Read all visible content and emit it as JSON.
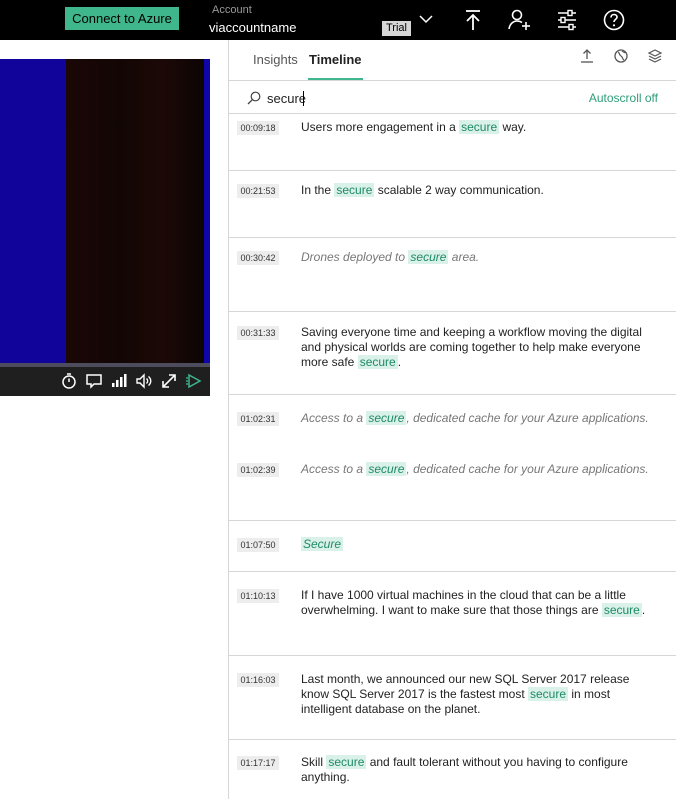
{
  "topbar": {
    "connect_button": "Connect to Azure",
    "account_label": "Account",
    "account_name": "viaccountname",
    "trial_badge": "Trial",
    "icons": [
      "chevron-down-icon",
      "upload-icon",
      "add-person-icon",
      "settings-sliders-icon",
      "help-icon"
    ]
  },
  "player": {
    "controls": [
      "timer-icon",
      "captions-icon",
      "quality-icon",
      "volume-icon",
      "fullscreen-icon",
      "play-speed-icon"
    ]
  },
  "panel": {
    "tabs": [
      {
        "label": "Insights",
        "active": false
      },
      {
        "label": "Timeline",
        "active": true
      }
    ],
    "header_icons": [
      "export-icon",
      "globe-icon",
      "layers-icon"
    ],
    "search": {
      "value": "secure",
      "placeholder": ""
    },
    "autoscroll_label": "Autoscroll off"
  },
  "transcript": [
    {
      "lines": [
        {
          "time": "00:09:18",
          "italic": false,
          "parts": [
            "Users more engagement in a ",
            "secure",
            " way."
          ]
        }
      ]
    },
    {
      "lines": [
        {
          "time": "00:21:53",
          "italic": false,
          "parts": [
            "In the ",
            "secure",
            " scalable 2 way communication."
          ]
        }
      ]
    },
    {
      "lines": [
        {
          "time": "00:30:42",
          "italic": true,
          "parts": [
            "Drones deployed to ",
            "secure",
            " area."
          ]
        }
      ]
    },
    {
      "lines": [
        {
          "time": "00:31:33",
          "italic": false,
          "parts": [
            "Saving everyone time and keeping a workflow moving the digital and physical worlds are coming together to help make everyone more safe ",
            "secure",
            "."
          ]
        }
      ]
    },
    {
      "lines": [
        {
          "time": "01:02:31",
          "italic": true,
          "parts": [
            "Access to a ",
            "secure",
            ", dedicated cache for your Azure applications."
          ]
        },
        {
          "time": "01:02:39",
          "italic": true,
          "parts": [
            "Access to a ",
            "secure",
            ", dedicated cache for your Azure applications."
          ]
        }
      ]
    },
    {
      "lines": [
        {
          "time": "01:07:50",
          "italic": true,
          "parts": [
            "",
            "Secure",
            ""
          ]
        }
      ]
    },
    {
      "lines": [
        {
          "time": "01:10:13",
          "italic": false,
          "parts": [
            "If I have 1000 virtual machines in the cloud that can be a little overwhelming. I want to make sure that those things are ",
            "secure",
            "."
          ]
        }
      ]
    },
    {
      "lines": [
        {
          "time": "01:16:03",
          "italic": false,
          "parts": [
            "Last month, we announced our new SQL Server 2017 release know SQL Server 2017 is the fastest most ",
            "secure",
            " in most intelligent database on the planet."
          ]
        }
      ]
    },
    {
      "lines": [
        {
          "time": "01:17:17",
          "italic": false,
          "parts": [
            "Skill ",
            "secure",
            " and fault tolerant without you having to configure anything."
          ]
        }
      ]
    }
  ]
}
